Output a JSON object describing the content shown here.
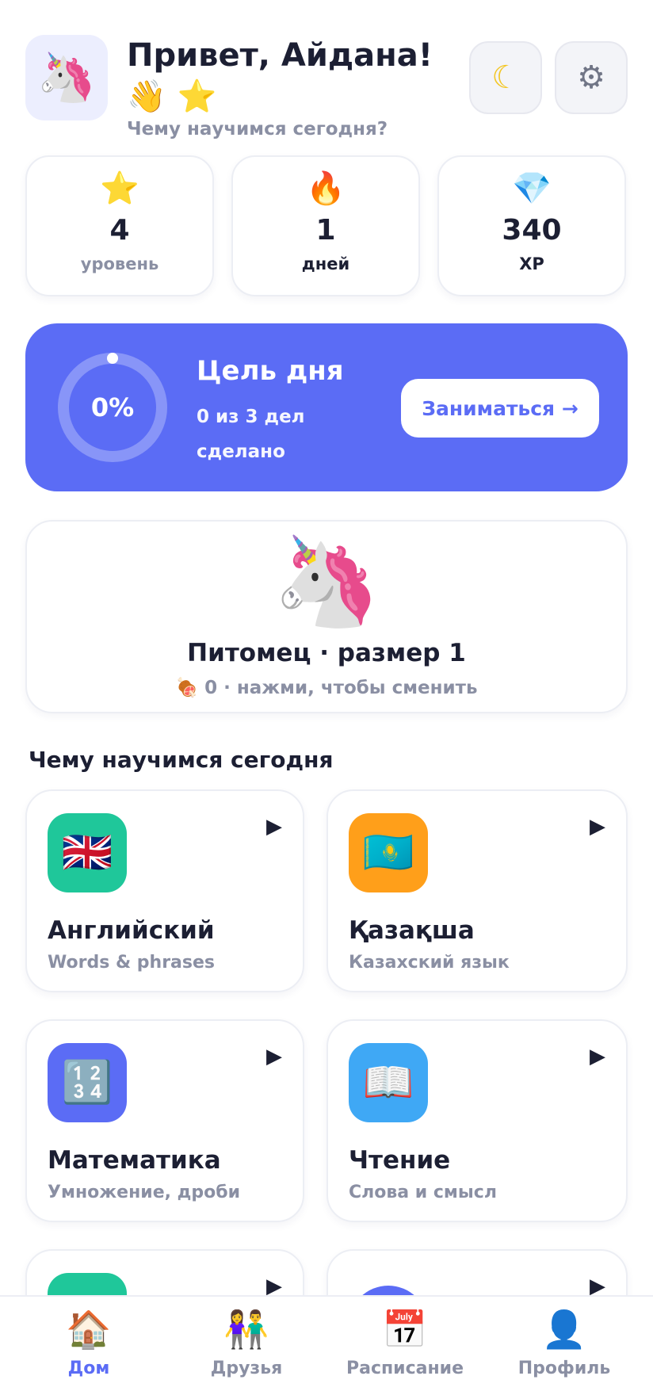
{
  "header": {
    "avatar_icon": "🦄",
    "greeting": "Привет, Айдана! 👋 ⭐",
    "subtitle": "Чему научимся сегодня?",
    "theme_icon": "☾",
    "settings_icon": "⚙"
  },
  "stats": [
    {
      "icon": "⭐",
      "value": "4",
      "label": "уровень"
    },
    {
      "icon": "🔥",
      "value": "1",
      "label": "дней"
    },
    {
      "icon": "💎",
      "value": "340",
      "label": "XP"
    }
  ],
  "goal": {
    "percent_text": "0%",
    "progress": 0,
    "title": "Цель дня",
    "description": "0 из 3 дел сделано",
    "button_label": "Заниматься →"
  },
  "pet": {
    "icon": "🦄",
    "title": "Питомец · размер 1",
    "subtitle": "🍖 0 · нажми, чтобы сменить"
  },
  "section_title": "Чему научимся сегодня",
  "subjects": [
    {
      "icon": "🇬🇧",
      "color": "#1fc79a",
      "title": "Английский",
      "subtitle": "Words & phrases"
    },
    {
      "icon": "🇰🇿",
      "color": "#ff9f1a",
      "title": "Қазақша",
      "subtitle": "Казахский язык"
    },
    {
      "icon": "🔢",
      "color": "#5b6cf5",
      "title": "Математика",
      "subtitle": "Умножение, дроби"
    },
    {
      "icon": "📖",
      "color": "#3fa8f5",
      "title": "Чтение",
      "subtitle": "Слова и смысл"
    },
    {
      "icon": "",
      "color": "#1fc79a",
      "title": "",
      "subtitle": ""
    },
    {
      "icon": "",
      "color": "#5b6cf5",
      "title": "",
      "subtitle": ""
    }
  ],
  "play_icon": "▶",
  "nav": [
    {
      "icon": "🏠",
      "label": "Дом",
      "active": true
    },
    {
      "icon": "👫",
      "label": "Друзья",
      "active": false
    },
    {
      "icon": "📅",
      "label": "Расписание",
      "active": false
    },
    {
      "icon": "👤",
      "label": "Профиль",
      "active": false
    }
  ]
}
